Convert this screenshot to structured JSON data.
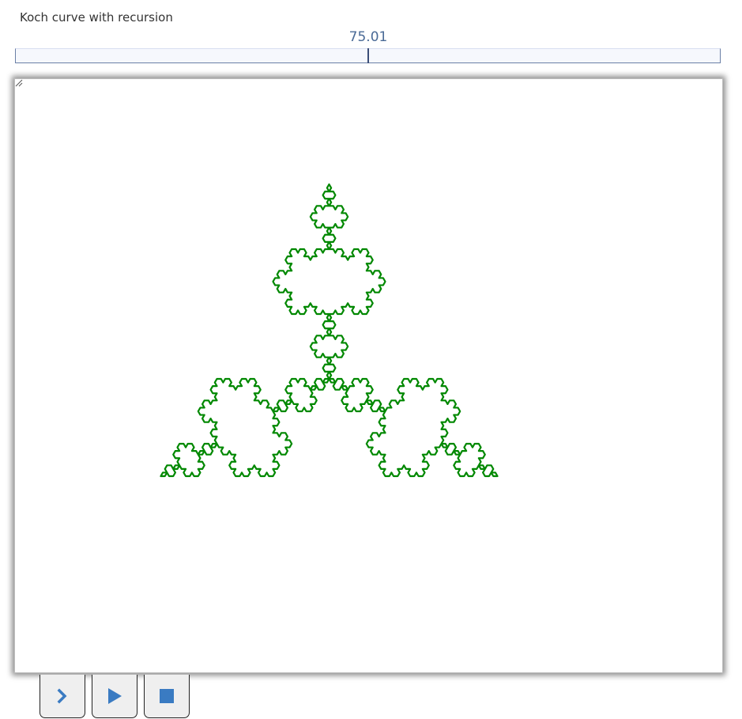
{
  "header": {
    "title": "Koch curve with recursion"
  },
  "slider": {
    "value_label": "75.01"
  },
  "canvas": {
    "curve_color": "#008800",
    "recursion_depth": 4,
    "shape": "koch-snowflake"
  },
  "controls": {
    "step_icon": "chevron-right-icon",
    "play_icon": "play-icon",
    "stop_icon": "stop-icon",
    "icon_color": "#3a7bc2"
  }
}
